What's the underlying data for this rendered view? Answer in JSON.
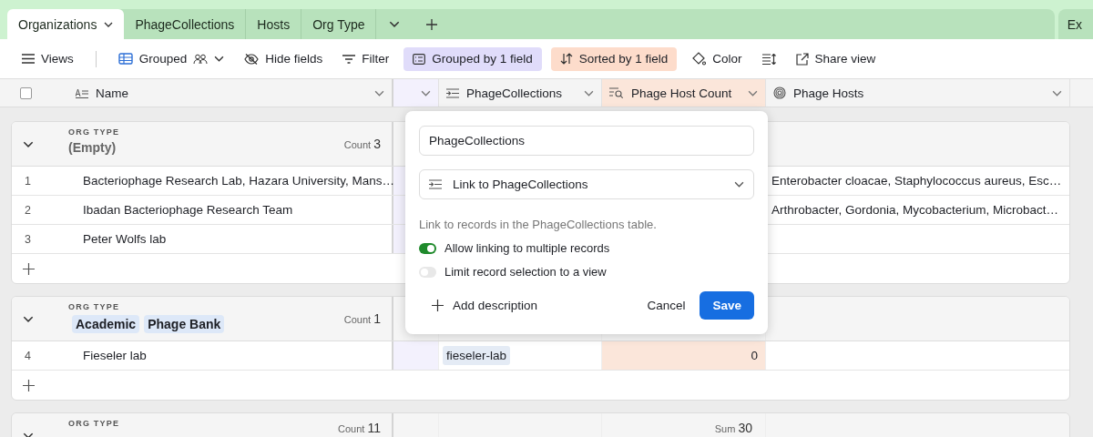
{
  "tabs": [
    {
      "label": "Organizations",
      "selected": true,
      "has_menu": true
    },
    {
      "label": "PhageCollections",
      "selected": false,
      "has_menu": false
    },
    {
      "label": "Hosts",
      "selected": false,
      "has_menu": false
    },
    {
      "label": "Org Type",
      "selected": false,
      "has_menu": false
    }
  ],
  "overflow_tab": {
    "label": "Ex"
  },
  "toolbar": [
    {
      "kind": "views",
      "label": "Views"
    },
    {
      "kind": "view-select",
      "label": "Grouped"
    },
    {
      "kind": "hide",
      "label": "Hide fields"
    },
    {
      "kind": "filter",
      "label": "Filter"
    },
    {
      "kind": "group",
      "label": "Grouped by 1 field"
    },
    {
      "kind": "sort",
      "label": "Sorted by 1 field"
    },
    {
      "kind": "color",
      "label": "Color"
    },
    {
      "kind": "row-height"
    },
    {
      "kind": "share",
      "label": "Share view"
    }
  ],
  "columns": [
    {
      "kind": "primary",
      "label": "Name"
    },
    {
      "kind": "grouped"
    },
    {
      "kind": "link",
      "label": "PhageCollections"
    },
    {
      "kind": "count",
      "label": "Phage Host Count",
      "sorted": true
    },
    {
      "kind": "lookup",
      "label": "Phage Hosts"
    }
  ],
  "groups": [
    {
      "field": "ORG TYPE",
      "value": "(Empty)",
      "count_label": "Count",
      "count": "3",
      "rows": [
        {
          "number": "1",
          "name": "Bacteriophage Research Lab, Hazara University, Mans…",
          "hosts": "Enterobacter cloacae, Staphylococcus aureus, Esc…"
        },
        {
          "number": "2",
          "name": "Ibadan Bacteriophage Research Team",
          "hosts": "Arthrobacter, Gordonia, Mycobacterium, Microbact…"
        },
        {
          "number": "3",
          "name": "Peter Wolfs lab"
        }
      ]
    },
    {
      "field": "ORG TYPE",
      "tags": [
        "Academic",
        "Phage Bank"
      ],
      "count_label": "Count",
      "count": "1",
      "rows": [
        {
          "number": "4",
          "name": "Fieseler lab",
          "collection": "fieseler-lab",
          "host_count": "0"
        }
      ]
    },
    {
      "field": "ORG TYPE",
      "count_label": "Count",
      "count": "11",
      "summary_label": "Sum",
      "summary": "30"
    }
  ],
  "select_all": {
    "checked": false
  },
  "popover": {
    "field_name": "PhageCollections",
    "field_type": "Link to PhageCollections",
    "description": "Link to records in the PhageCollections table.",
    "toggles": [
      {
        "label": "Allow linking to multiple records",
        "on": true
      },
      {
        "label": "Limit record selection to a view",
        "on": false
      }
    ],
    "add_description": "Add description",
    "cancel": "Cancel",
    "save": "Save"
  }
}
